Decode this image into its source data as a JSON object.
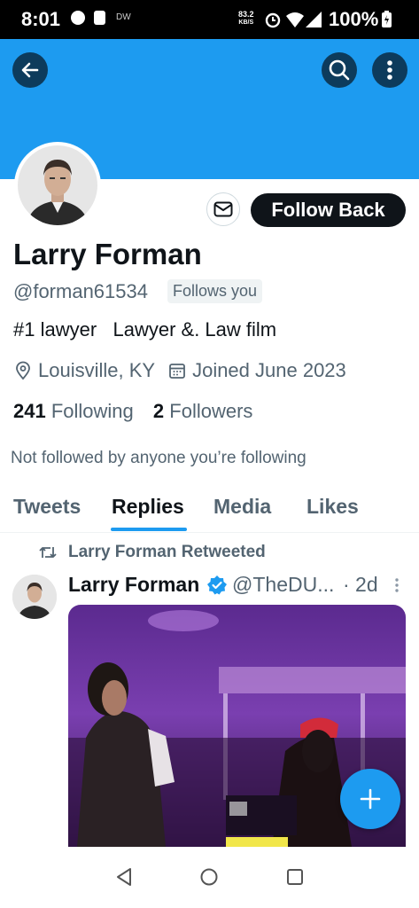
{
  "status_bar": {
    "time": "8:01",
    "small_label": "DW",
    "net_speed_value": "83.2",
    "net_speed_unit": "KB/S",
    "battery": "100%"
  },
  "header": {
    "back_icon": "arrow-left-icon",
    "search_icon": "search-icon",
    "more_icon": "more-vertical-icon",
    "banner_color": "#1d9bf0"
  },
  "profile": {
    "message_icon": "envelope-icon",
    "follow_label": "Follow Back",
    "name": "Larry Forman",
    "handle": "@forman61534",
    "follows_you": "Follows you",
    "bio": "#1 lawyer   Lawyer &. Law film",
    "location": "Louisville, KY",
    "joined": "Joined June 2023",
    "following_count": "241",
    "following_label": "Following",
    "followers_count": "2",
    "followers_label": "Followers",
    "not_followed": "Not followed by anyone you’re following"
  },
  "tabs": [
    {
      "label": "Tweets",
      "active": false
    },
    {
      "label": "Replies",
      "active": true
    },
    {
      "label": "Media",
      "active": false
    },
    {
      "label": "Likes",
      "active": false
    }
  ],
  "tweet": {
    "retweet_label": "Larry Forman Retweeted",
    "author_name": "Larry Forman",
    "author_handle": "@TheDU...",
    "time": "· 2d",
    "verified": true
  },
  "fab": {
    "icon": "plus-icon"
  },
  "nav": {
    "back": "triangle-back-icon",
    "home": "circle-home-icon",
    "recents": "square-recents-icon"
  },
  "colors": {
    "accent": "#1d9bf0",
    "text": "#0f1419",
    "secondary": "#536471"
  }
}
